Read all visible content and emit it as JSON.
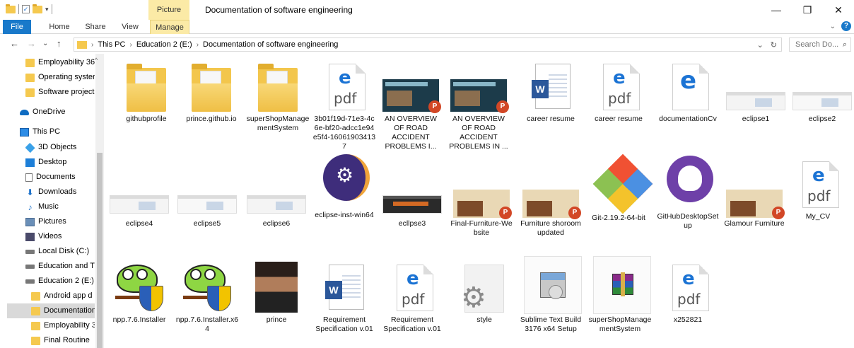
{
  "titlebar": {
    "context_tab": "Picture Tools",
    "title": "Documentation of software engineering",
    "minimize": "—",
    "maximize": "❐",
    "close": "✕"
  },
  "ribbon": {
    "tabs": [
      "File",
      "Home",
      "Share",
      "View",
      "Manage"
    ],
    "help": "?"
  },
  "address": {
    "back": "←",
    "forward": "→",
    "recent": "⌄",
    "up": "↑",
    "crumbs": [
      "This PC",
      "Education 2 (E:)",
      "Documentation of software engineering"
    ],
    "search_placeholder": "Search Do...",
    "refresh": "↻"
  },
  "sidebar": {
    "items": [
      {
        "label": "Employability 36",
        "icon": "folder-icon"
      },
      {
        "label": "Operating syster",
        "icon": "folder-icon"
      },
      {
        "label": "Software project",
        "icon": "folder-icon"
      },
      {
        "label": "OneDrive",
        "icon": "cloud-icon"
      },
      {
        "label": "This PC",
        "icon": "computer-icon"
      },
      {
        "label": "3D Objects",
        "icon": "cube-icon"
      },
      {
        "label": "Desktop",
        "icon": "desktop-icon"
      },
      {
        "label": "Documents",
        "icon": "document-icon"
      },
      {
        "label": "Downloads",
        "icon": "download-icon"
      },
      {
        "label": "Music",
        "icon": "music-icon"
      },
      {
        "label": "Pictures",
        "icon": "picture-icon"
      },
      {
        "label": "Videos",
        "icon": "video-icon"
      },
      {
        "label": "Local Disk (C:)",
        "icon": "disk-icon"
      },
      {
        "label": "Education and T",
        "icon": "disk-icon"
      },
      {
        "label": "Education 2 (E:)",
        "icon": "disk-icon"
      },
      {
        "label": "Android app d",
        "icon": "folder-icon"
      },
      {
        "label": "Documentation",
        "icon": "folder-icon",
        "selected": true
      },
      {
        "label": "Employability 3",
        "icon": "folder-icon"
      },
      {
        "label": "Final Routine",
        "icon": "folder-icon"
      }
    ]
  },
  "files": [
    {
      "name": "githubprofile",
      "type": "folder"
    },
    {
      "name": "prince.github.io",
      "type": "folder"
    },
    {
      "name": "superShopManagementSystem",
      "type": "folder"
    },
    {
      "name": "3b01f19d-71e3-4c6e-bf20-adcc1e94e5f4-160619034137",
      "type": "pdf"
    },
    {
      "name": "AN OVERVIEW OF ROAD ACCIDENT PROBLEMS I...",
      "type": "pptx"
    },
    {
      "name": "AN OVERVIEW OF ROAD ACCIDENT PROBLEMS IN ...",
      "type": "pptx"
    },
    {
      "name": "career resume",
      "type": "docx"
    },
    {
      "name": "career resume",
      "type": "pdf"
    },
    {
      "name": "documentationCv",
      "type": "edge"
    },
    {
      "name": "eclipse1",
      "type": "image"
    },
    {
      "name": "eclipse2",
      "type": "image"
    },
    {
      "name": "eclipse4",
      "type": "image"
    },
    {
      "name": "eclipse5",
      "type": "image"
    },
    {
      "name": "eclipse6",
      "type": "image"
    },
    {
      "name": "eclipse-inst-win64",
      "type": "eclipse"
    },
    {
      "name": "ecllpse3",
      "type": "image-dark"
    },
    {
      "name": "Final-Furniture-Website",
      "type": "pptx"
    },
    {
      "name": "Furniture shoroom updated",
      "type": "pptx"
    },
    {
      "name": "Git-2.19.2-64-bit",
      "type": "git"
    },
    {
      "name": "GitHubDesktopSetup",
      "type": "github"
    },
    {
      "name": "Glamour Furniture",
      "type": "pptx"
    },
    {
      "name": "My_CV",
      "type": "pdf-tall"
    },
    {
      "name": "npp.7.6.Installer",
      "type": "npp"
    },
    {
      "name": "npp.7.6.Installer.x64",
      "type": "npp"
    },
    {
      "name": "prince",
      "type": "photo"
    },
    {
      "name": "Requirement Specification v.01",
      "type": "docx"
    },
    {
      "name": "Requirement Specification v.01",
      "type": "pdf"
    },
    {
      "name": "style",
      "type": "gear"
    },
    {
      "name": "Sublime Text Build 3176 x64 Setup",
      "type": "installer"
    },
    {
      "name": "superShopManagementSystem",
      "type": "rar"
    },
    {
      "name": "x252821",
      "type": "pdf"
    }
  ],
  "colors": {
    "accent": "#1979ca",
    "context_tab": "#fbeaa6",
    "selected": "#d9d9d9"
  }
}
